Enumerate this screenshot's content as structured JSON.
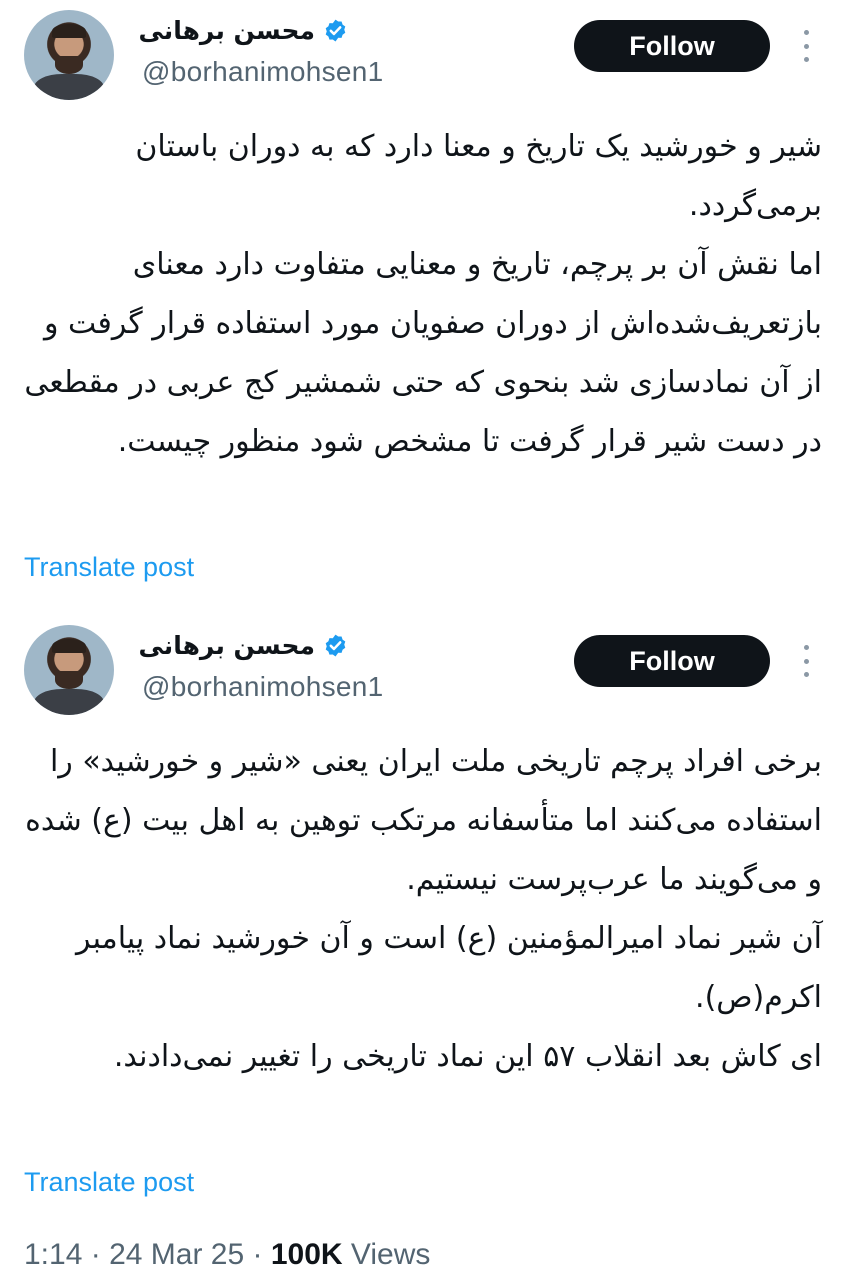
{
  "tweets": [
    {
      "author_name": "محسن برهانی",
      "handle": "@borhanimohsen1",
      "follow_label": "Follow",
      "text": "شیر و خورشید یک تاریخ و معنا دارد که به دوران باستان برمی‌گردد.\nاما نقش آن بر پرچم، تاریخ و معنایی متفاوت دارد معنای بازتعریف‌شده‌اش از دوران صفویان مورد استفاده قرار گرفت و از آن نمادسازی شد بنحوی که حتی شمشیر کج عربی در مقطعی در دست شیر قرار گرفت تا مشخص شود منظور چیست.",
      "translate_label": "Translate post"
    },
    {
      "author_name": "محسن برهانی",
      "handle": "@borhanimohsen1",
      "follow_label": "Follow",
      "text": "برخی افراد پرچم تاریخی ملت ایران یعنی «شیر و خورشید» را استفاده می‌کنند اما متأسفانه مرتکب توهین به اهل بیت (ع) شده و می‌گویند ما عرب‌پرست نیستیم.\nآن شیر نماد امیرالمؤمنین (ع) است و آن خورشید نماد پیامبر اکرم(ص).\nای کاش بعد انقلاب ۵۷ این نماد تاریخی را تغییر نمی‌دادند.",
      "translate_label": "Translate post"
    }
  ],
  "meta": {
    "time": "1:14",
    "date": "24 Mar 25",
    "views_count": "100K",
    "views_label": "Views",
    "separator": "·"
  },
  "colors": {
    "verified": "#1d9bf0",
    "link": "#1d9bf0",
    "secondary_text": "#536471",
    "follow_bg": "#0f1419"
  },
  "icons": {
    "verified": "verified-badge-icon",
    "more": "more-vertical-icon"
  }
}
